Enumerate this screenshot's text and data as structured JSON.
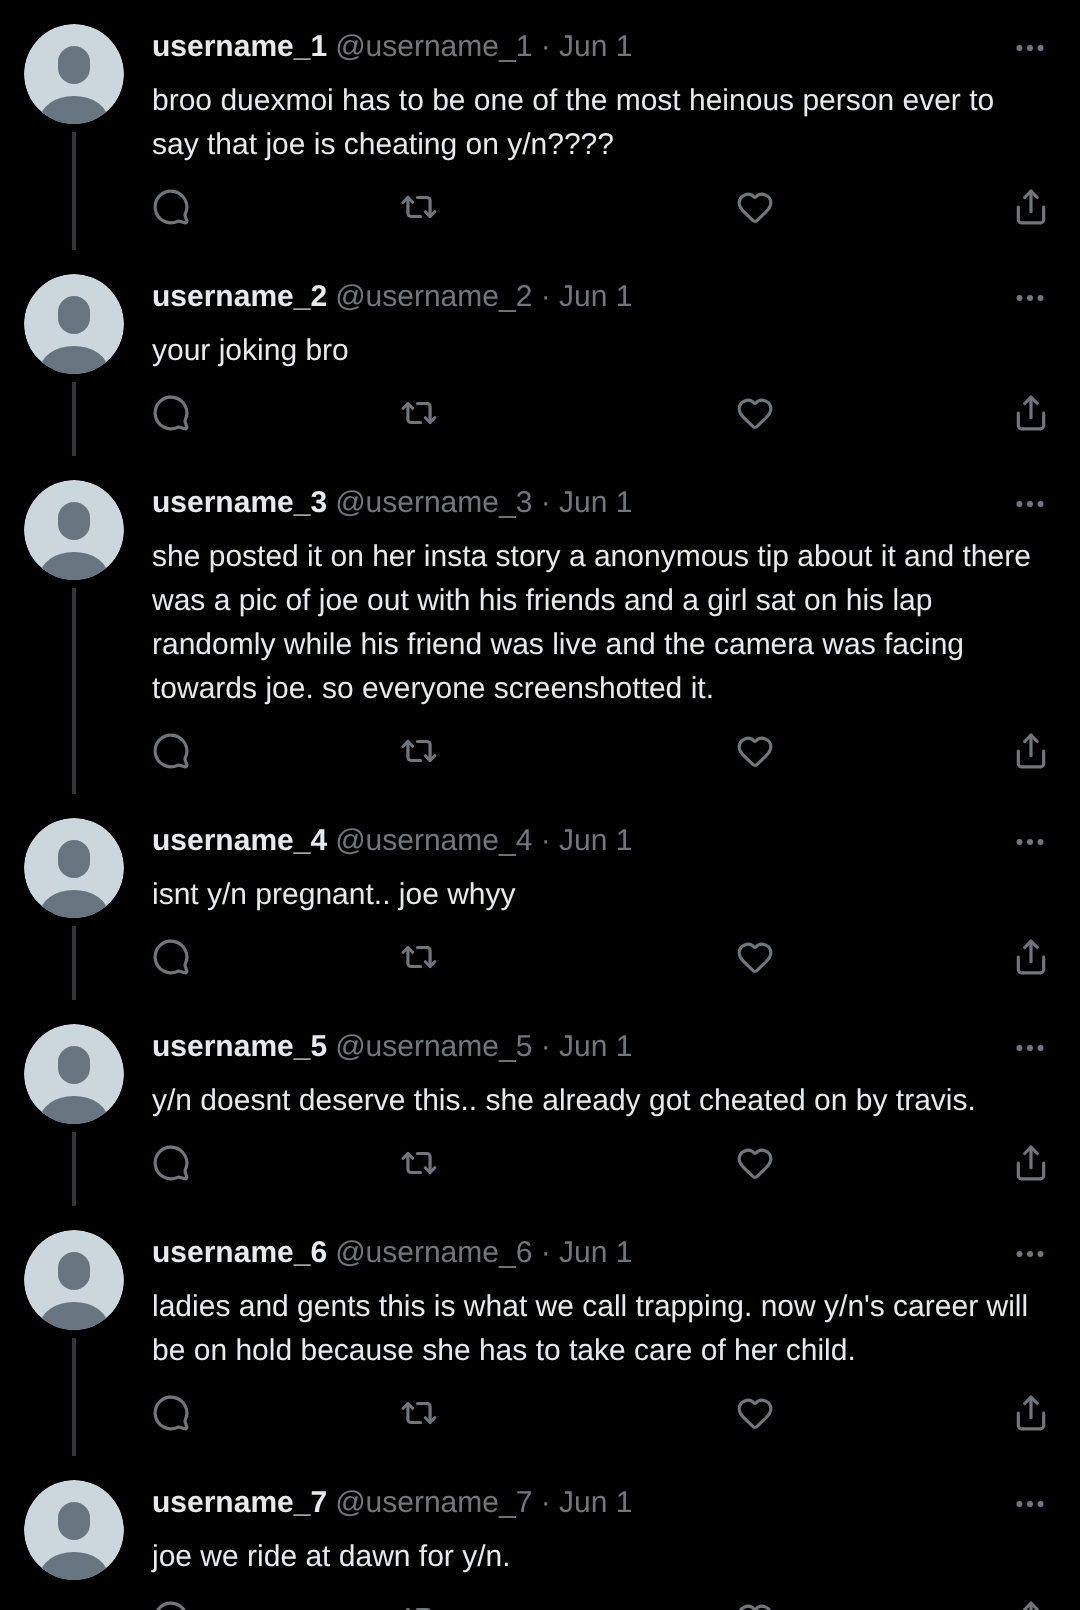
{
  "tweets": [
    {
      "name": "username_1",
      "meta": "@username_1 · Jun 1",
      "text": "broo duexmoi has to be one of the most heinous person ever to say that joe is cheating on y/n????"
    },
    {
      "name": "username_2",
      "meta": "@username_2 · Jun 1",
      "text": "your joking bro"
    },
    {
      "name": "username_3",
      "meta": "@username_3 · Jun 1",
      "text": "she posted it on her insta story a anonymous tip about it and there was a pic of joe out with his friends and a girl sat on his lap randomly while his friend was live and the camera was facing towards joe. so everyone screenshotted it."
    },
    {
      "name": "username_4",
      "meta": "@username_4 · Jun 1",
      "text": "isnt y/n pregnant.. joe whyy"
    },
    {
      "name": "username_5",
      "meta": "@username_5 · Jun 1",
      "text": "y/n doesnt deserve this.. she already got cheated on by travis."
    },
    {
      "name": "username_6",
      "meta": "@username_6 · Jun 1",
      "text": "ladies and gents this is what we call trapping. now y/n's career will be on hold because she has to take care of her child."
    },
    {
      "name": "username_7",
      "meta": "@username_7 · Jun 1",
      "text": "joe we ride at dawn for y/n."
    }
  ]
}
